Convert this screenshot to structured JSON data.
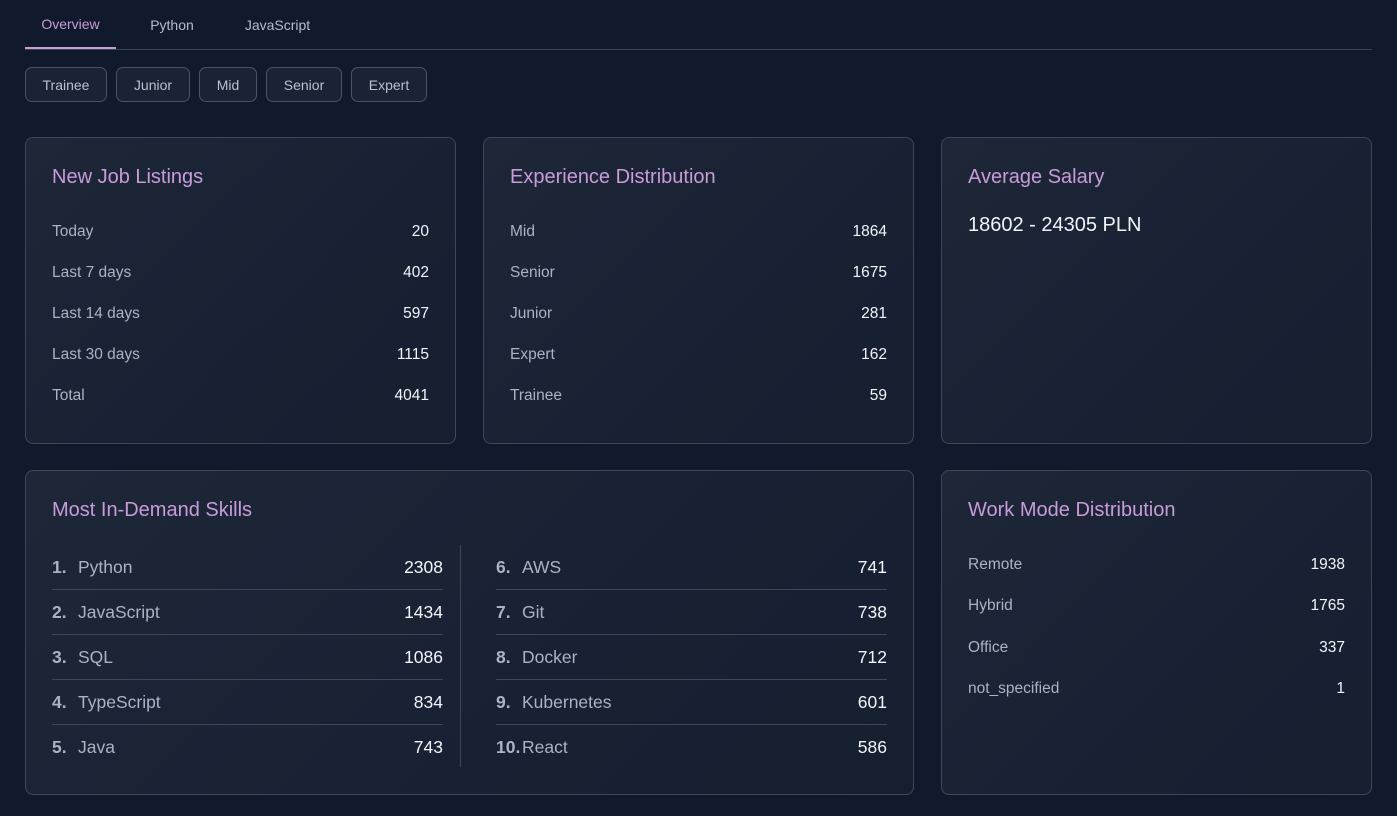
{
  "tabs": [
    {
      "label": "Overview",
      "active": true
    },
    {
      "label": "Python",
      "active": false
    },
    {
      "label": "JavaScript",
      "active": false
    }
  ],
  "filters": [
    "Trainee",
    "Junior",
    "Mid",
    "Senior",
    "Expert"
  ],
  "colors": {
    "background": "#111a2c",
    "accent": "#c89bd9",
    "card_border": "#3e4759",
    "text_value": "#f2f4f8",
    "text_label": "#aab3c2"
  },
  "new_listings": {
    "title": "New Job Listings",
    "rows": [
      {
        "label": "Today",
        "value": "20"
      },
      {
        "label": "Last 7 days",
        "value": "402"
      },
      {
        "label": "Last 14 days",
        "value": "597"
      },
      {
        "label": "Last 30 days",
        "value": "1115"
      },
      {
        "label": "Total",
        "value": "4041"
      }
    ]
  },
  "experience": {
    "title": "Experience Distribution",
    "rows": [
      {
        "label": "Mid",
        "value": "1864"
      },
      {
        "label": "Senior",
        "value": "1675"
      },
      {
        "label": "Junior",
        "value": "281"
      },
      {
        "label": "Expert",
        "value": "162"
      },
      {
        "label": "Trainee",
        "value": "59"
      }
    ]
  },
  "salary": {
    "title": "Average Salary",
    "value": "18602 - 24305 PLN"
  },
  "skills": {
    "title": "Most In-Demand Skills",
    "items": [
      {
        "rank": "1.",
        "name": "Python",
        "count": "2308"
      },
      {
        "rank": "2.",
        "name": "JavaScript",
        "count": "1434"
      },
      {
        "rank": "3.",
        "name": "SQL",
        "count": "1086"
      },
      {
        "rank": "4.",
        "name": "TypeScript",
        "count": "834"
      },
      {
        "rank": "5.",
        "name": "Java",
        "count": "743"
      },
      {
        "rank": "6.",
        "name": "AWS",
        "count": "741"
      },
      {
        "rank": "7.",
        "name": "Git",
        "count": "738"
      },
      {
        "rank": "8.",
        "name": "Docker",
        "count": "712"
      },
      {
        "rank": "9.",
        "name": "Kubernetes",
        "count": "601"
      },
      {
        "rank": "10.",
        "name": "React",
        "count": "586"
      }
    ]
  },
  "work_mode": {
    "title": "Work Mode Distribution",
    "rows": [
      {
        "label": "Remote",
        "value": "1938"
      },
      {
        "label": "Hybrid",
        "value": "1765"
      },
      {
        "label": "Office",
        "value": "337"
      },
      {
        "label": "not_specified",
        "value": "1"
      }
    ]
  }
}
